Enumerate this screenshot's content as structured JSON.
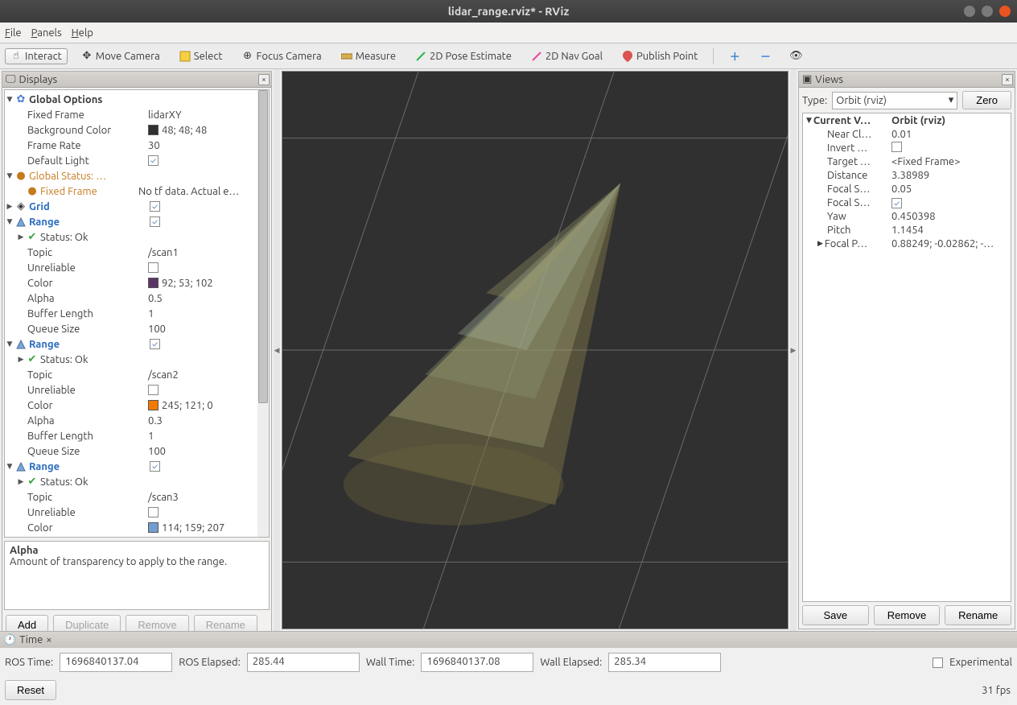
{
  "window": {
    "title": "lidar_range.rviz* - RViz"
  },
  "menu": {
    "file": "File",
    "panels": "Panels",
    "help": "Help"
  },
  "toolbar": {
    "interact": "Interact",
    "move_camera": "Move Camera",
    "select": "Select",
    "focus_camera": "Focus Camera",
    "measure": "Measure",
    "pose_estimate": "2D Pose Estimate",
    "nav_goal": "2D Nav Goal",
    "publish_point": "Publish Point"
  },
  "displays": {
    "title": "Displays",
    "global_options": "Global Options",
    "fixed_frame_label": "Fixed Frame",
    "fixed_frame_value": "lidarXY",
    "bg_label": "Background Color",
    "bg_value": "48; 48; 48",
    "frame_rate_label": "Frame Rate",
    "frame_rate_value": "30",
    "default_light_label": "Default Light",
    "global_status_label": "Global Status: …",
    "fixed_frame_err_label": "Fixed Frame",
    "fixed_frame_err_value": "No tf data.  Actual e…",
    "grid_label": "Grid",
    "range_label": "Range",
    "status_ok": "Status: Ok",
    "topic_label": "Topic",
    "unreliable_label": "Unreliable",
    "color_label": "Color",
    "alpha_label": "Alpha",
    "buffer_label": "Buffer Length",
    "queue_label": "Queue Size",
    "range1": {
      "topic": "/scan1",
      "color": "92; 53; 102",
      "color_hex": "#5c3566",
      "alpha": "0.5",
      "buffer": "1",
      "queue": "100"
    },
    "range2": {
      "topic": "/scan2",
      "color": "245; 121; 0",
      "color_hex": "#f57900",
      "alpha": "0.3",
      "buffer": "1",
      "queue": "100"
    },
    "range3": {
      "topic": "/scan3",
      "color": "114; 159; 207",
      "color_hex": "#729fcf"
    },
    "desc_title": "Alpha",
    "desc_body": "Amount of transparency to apply to the range.",
    "btn_add": "Add",
    "btn_duplicate": "Duplicate",
    "btn_remove": "Remove",
    "btn_rename": "Rename"
  },
  "views": {
    "title": "Views",
    "type_label": "Type:",
    "type_value": "Orbit (rviz)",
    "zero": "Zero",
    "current_view": "Current V…",
    "current_view_val": "Orbit (rviz)",
    "near_clip": "Near Cl…",
    "near_clip_val": "0.01",
    "invert": "Invert …",
    "target": "Target …",
    "target_val": "<Fixed Frame>",
    "distance": "Distance",
    "distance_val": "3.38989",
    "focal_s1": "Focal S…",
    "focal_s1_val": "0.05",
    "focal_s2": "Focal S…",
    "yaw": "Yaw",
    "yaw_val": "0.450398",
    "pitch": "Pitch",
    "pitch_val": "1.1454",
    "focal_p": "Focal P…",
    "focal_p_val": "0.88249; -0.02862; -…",
    "save": "Save",
    "remove": "Remove",
    "rename": "Rename"
  },
  "time": {
    "title": "Time",
    "ros_time_label": "ROS Time:",
    "ros_time": "1696840137.04",
    "ros_elapsed_label": "ROS Elapsed:",
    "ros_elapsed": "285.44",
    "wall_time_label": "Wall Time:",
    "wall_time": "1696840137.08",
    "wall_elapsed_label": "Wall Elapsed:",
    "wall_elapsed": "285.34",
    "experimental": "Experimental",
    "reset": "Reset",
    "fps": "31 fps"
  }
}
